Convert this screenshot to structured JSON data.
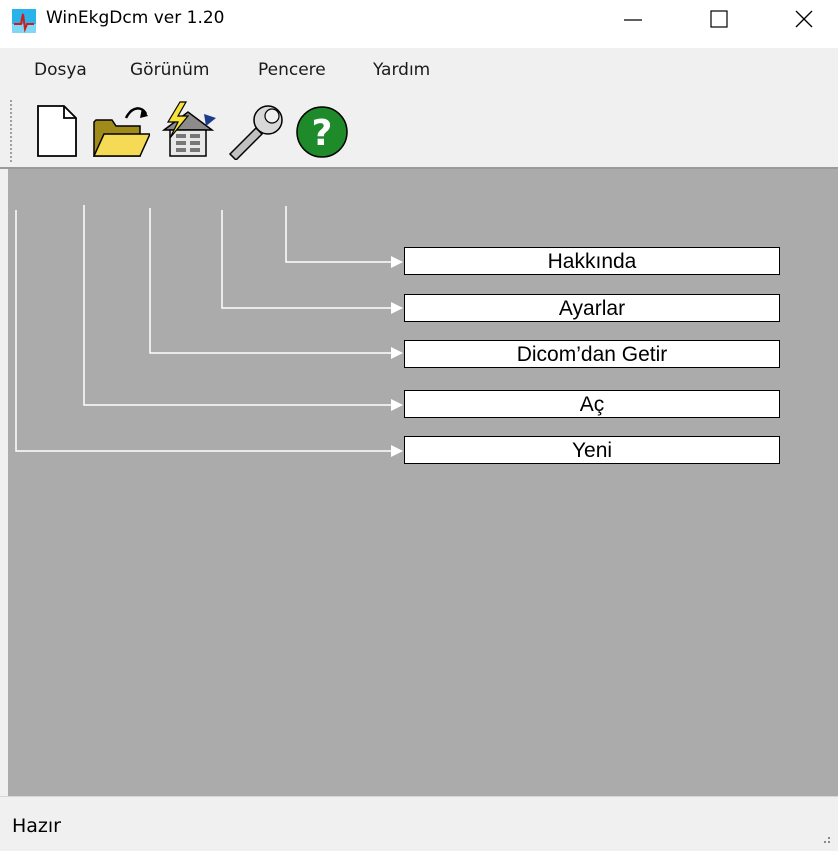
{
  "window": {
    "title": "WinEkgDcm ver 1.20"
  },
  "menu": [
    "Dosya",
    "Görünüm",
    "Pencere",
    "Yardım"
  ],
  "toolbar": {
    "icons": [
      "new-document-icon",
      "open-folder-icon",
      "dicom-import-icon",
      "settings-wrench-icon",
      "help-icon"
    ]
  },
  "callouts": {
    "hakkinda": "Hakkında",
    "ayarlar": "Ayarlar",
    "dicom": "Dicom’dan Getir",
    "ac": "Aç",
    "yeni": "Yeni"
  },
  "status": {
    "text": "Hazır"
  },
  "colors": {
    "client_bg": "#ababab",
    "chrome_bg": "#f0f0f0",
    "help_green": "#1e8a2a",
    "title_icon": "#1fa5e0"
  }
}
